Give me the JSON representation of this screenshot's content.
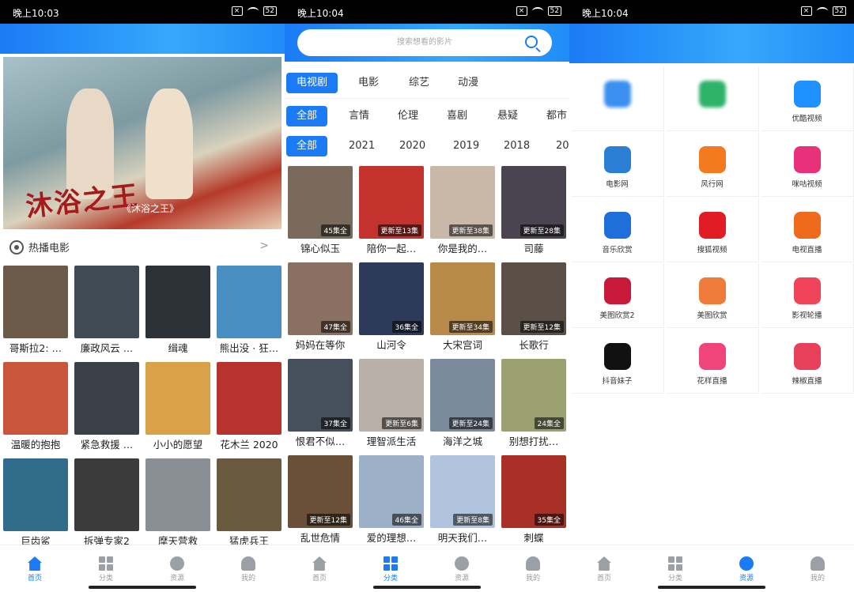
{
  "status_bars": [
    {
      "time": "晚上10:03",
      "battery": "52"
    },
    {
      "time": "晚上10:04",
      "battery": "52"
    },
    {
      "time": "晚上10:04",
      "battery": "52"
    }
  ],
  "colors": {
    "accent": "#1a7bf5"
  },
  "home": {
    "banner": {
      "title": "沐浴之王",
      "subtitle": "《沐浴之王》"
    },
    "hot_section": {
      "title": "热播电影",
      "more": ">"
    },
    "movies": [
      "哥斯拉2: …",
      "廉政风云 …",
      "缉魂",
      "熊出没 · 狂…",
      "温暖的抱抱",
      "紧急救援 …",
      "小小的愿望",
      "花木兰 2020",
      "巨齿鲨",
      "拆弹专家2",
      "摩天营救",
      "猛虎兵王"
    ]
  },
  "category": {
    "search_placeholder": "搜索想看的影片",
    "type_tabs": [
      "电视剧",
      "电影",
      "综艺",
      "动漫"
    ],
    "genre_tabs": [
      "全部",
      "言情",
      "伦理",
      "喜剧",
      "悬疑",
      "都市"
    ],
    "year_tabs": [
      "全部",
      "2021",
      "2020",
      "2019",
      "2018",
      "20"
    ],
    "shows": [
      {
        "title": "锦心似玉",
        "badge": "45集全"
      },
      {
        "title": "陪你一起…",
        "badge": "更新至13集"
      },
      {
        "title": "你是我的…",
        "badge": "更新至38集"
      },
      {
        "title": "司藤",
        "badge": "更新至28集"
      },
      {
        "title": "妈妈在等你",
        "badge": "47集全"
      },
      {
        "title": "山河令",
        "badge": "36集全"
      },
      {
        "title": "大宋宫词",
        "badge": "更新至34集"
      },
      {
        "title": "长歌行",
        "badge": "更新至12集"
      },
      {
        "title": "恨君不似…",
        "badge": "37集全"
      },
      {
        "title": "理智派生活",
        "badge": "更新至6集"
      },
      {
        "title": "海洋之城",
        "badge": "更新至24集"
      },
      {
        "title": "别想打扰…",
        "badge": "24集全"
      },
      {
        "title": "乱世危情",
        "badge": "更新至12集"
      },
      {
        "title": "爱的理想…",
        "badge": "46集全"
      },
      {
        "title": "明天我们…",
        "badge": "更新至8集"
      },
      {
        "title": "刺蝶",
        "badge": "35集全"
      }
    ]
  },
  "apps": [
    {
      "label": "",
      "icon": "blurred-app-icon",
      "color": "#3b8ff0"
    },
    {
      "label": "",
      "icon": "blurred-app-icon",
      "color": "#2fb36a"
    },
    {
      "label": "优酷视频",
      "icon": "youku-icon",
      "color": "#1e90ff"
    },
    {
      "label": "电影网",
      "icon": "m1905-icon",
      "color": "#2a7fd4"
    },
    {
      "label": "风行网",
      "icon": "funshion-icon",
      "color": "#f47a20"
    },
    {
      "label": "咪咕视频",
      "icon": "migu-icon",
      "color": "#e9307a"
    },
    {
      "label": "音乐欣赏",
      "icon": "music-note-icon",
      "color": "#1e6fd9"
    },
    {
      "label": "搜狐视频",
      "icon": "sohu-icon",
      "color": "#e21c24"
    },
    {
      "label": "电视直播",
      "icon": "tv-icon",
      "color": "#f06a1d"
    },
    {
      "label": "美图欣赏2",
      "icon": "gallery-icon",
      "color": "#c8193b"
    },
    {
      "label": "美图欣赏",
      "icon": "gallery-icon",
      "color": "#f07a3a"
    },
    {
      "label": "影视轮播",
      "icon": "carousel-icon",
      "color": "#f0445a"
    },
    {
      "label": "抖音妹子",
      "icon": "tiktok-icon",
      "color": "#111111"
    },
    {
      "label": "花样直播",
      "icon": "heart-live-icon",
      "color": "#f0447a"
    },
    {
      "label": "辣椒直播",
      "icon": "chili-live-icon",
      "color": "#e8405a"
    }
  ],
  "nav": [
    "首页",
    "分类",
    "资源",
    "我的"
  ]
}
